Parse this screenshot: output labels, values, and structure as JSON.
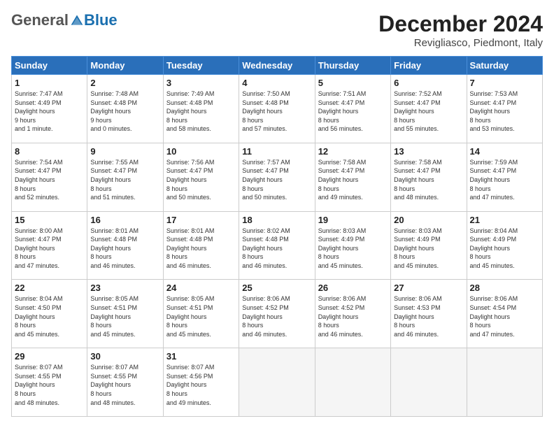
{
  "header": {
    "logo": {
      "general": "General",
      "blue": "Blue"
    },
    "title": "December 2024",
    "location": "Revigliasco, Piedmont, Italy"
  },
  "weekdays": [
    "Sunday",
    "Monday",
    "Tuesday",
    "Wednesday",
    "Thursday",
    "Friday",
    "Saturday"
  ],
  "weeks": [
    [
      {
        "day": "1",
        "sunrise": "7:47 AM",
        "sunset": "4:49 PM",
        "daylight": "9 hours and 1 minute."
      },
      {
        "day": "2",
        "sunrise": "7:48 AM",
        "sunset": "4:48 PM",
        "daylight": "9 hours and 0 minutes."
      },
      {
        "day": "3",
        "sunrise": "7:49 AM",
        "sunset": "4:48 PM",
        "daylight": "8 hours and 58 minutes."
      },
      {
        "day": "4",
        "sunrise": "7:50 AM",
        "sunset": "4:48 PM",
        "daylight": "8 hours and 57 minutes."
      },
      {
        "day": "5",
        "sunrise": "7:51 AM",
        "sunset": "4:47 PM",
        "daylight": "8 hours and 56 minutes."
      },
      {
        "day": "6",
        "sunrise": "7:52 AM",
        "sunset": "4:47 PM",
        "daylight": "8 hours and 55 minutes."
      },
      {
        "day": "7",
        "sunrise": "7:53 AM",
        "sunset": "4:47 PM",
        "daylight": "8 hours and 53 minutes."
      }
    ],
    [
      {
        "day": "8",
        "sunrise": "7:54 AM",
        "sunset": "4:47 PM",
        "daylight": "8 hours and 52 minutes."
      },
      {
        "day": "9",
        "sunrise": "7:55 AM",
        "sunset": "4:47 PM",
        "daylight": "8 hours and 51 minutes."
      },
      {
        "day": "10",
        "sunrise": "7:56 AM",
        "sunset": "4:47 PM",
        "daylight": "8 hours and 50 minutes."
      },
      {
        "day": "11",
        "sunrise": "7:57 AM",
        "sunset": "4:47 PM",
        "daylight": "8 hours and 50 minutes."
      },
      {
        "day": "12",
        "sunrise": "7:58 AM",
        "sunset": "4:47 PM",
        "daylight": "8 hours and 49 minutes."
      },
      {
        "day": "13",
        "sunrise": "7:58 AM",
        "sunset": "4:47 PM",
        "daylight": "8 hours and 48 minutes."
      },
      {
        "day": "14",
        "sunrise": "7:59 AM",
        "sunset": "4:47 PM",
        "daylight": "8 hours and 47 minutes."
      }
    ],
    [
      {
        "day": "15",
        "sunrise": "8:00 AM",
        "sunset": "4:47 PM",
        "daylight": "8 hours and 47 minutes."
      },
      {
        "day": "16",
        "sunrise": "8:01 AM",
        "sunset": "4:48 PM",
        "daylight": "8 hours and 46 minutes."
      },
      {
        "day": "17",
        "sunrise": "8:01 AM",
        "sunset": "4:48 PM",
        "daylight": "8 hours and 46 minutes."
      },
      {
        "day": "18",
        "sunrise": "8:02 AM",
        "sunset": "4:48 PM",
        "daylight": "8 hours and 46 minutes."
      },
      {
        "day": "19",
        "sunrise": "8:03 AM",
        "sunset": "4:49 PM",
        "daylight": "8 hours and 45 minutes."
      },
      {
        "day": "20",
        "sunrise": "8:03 AM",
        "sunset": "4:49 PM",
        "daylight": "8 hours and 45 minutes."
      },
      {
        "day": "21",
        "sunrise": "8:04 AM",
        "sunset": "4:49 PM",
        "daylight": "8 hours and 45 minutes."
      }
    ],
    [
      {
        "day": "22",
        "sunrise": "8:04 AM",
        "sunset": "4:50 PM",
        "daylight": "8 hours and 45 minutes."
      },
      {
        "day": "23",
        "sunrise": "8:05 AM",
        "sunset": "4:51 PM",
        "daylight": "8 hours and 45 minutes."
      },
      {
        "day": "24",
        "sunrise": "8:05 AM",
        "sunset": "4:51 PM",
        "daylight": "8 hours and 45 minutes."
      },
      {
        "day": "25",
        "sunrise": "8:06 AM",
        "sunset": "4:52 PM",
        "daylight": "8 hours and 46 minutes."
      },
      {
        "day": "26",
        "sunrise": "8:06 AM",
        "sunset": "4:52 PM",
        "daylight": "8 hours and 46 minutes."
      },
      {
        "day": "27",
        "sunrise": "8:06 AM",
        "sunset": "4:53 PM",
        "daylight": "8 hours and 46 minutes."
      },
      {
        "day": "28",
        "sunrise": "8:06 AM",
        "sunset": "4:54 PM",
        "daylight": "8 hours and 47 minutes."
      }
    ],
    [
      {
        "day": "29",
        "sunrise": "8:07 AM",
        "sunset": "4:55 PM",
        "daylight": "8 hours and 48 minutes."
      },
      {
        "day": "30",
        "sunrise": "8:07 AM",
        "sunset": "4:55 PM",
        "daylight": "8 hours and 48 minutes."
      },
      {
        "day": "31",
        "sunrise": "8:07 AM",
        "sunset": "4:56 PM",
        "daylight": "8 hours and 49 minutes."
      },
      null,
      null,
      null,
      null
    ]
  ]
}
